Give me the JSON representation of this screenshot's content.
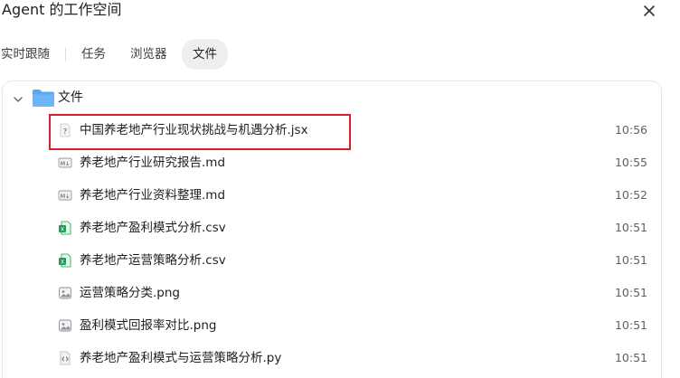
{
  "header": {
    "title": "Agent 的工作空间",
    "close_icon": "close-icon"
  },
  "tabs": [
    {
      "label": "实时跟随",
      "active": false
    },
    {
      "label": "任务",
      "active": false
    },
    {
      "label": "浏览器",
      "active": false
    },
    {
      "label": "文件",
      "active": true
    }
  ],
  "folder": {
    "label": "文件",
    "icon": "folder-icon",
    "expanded": true
  },
  "files": [
    {
      "name": "中国养老地产行业现状挑战与机遇分析.jsx",
      "time": "10:56",
      "icon": "unknown-file-icon"
    },
    {
      "name": "养老地产行业研究报告.md",
      "time": "10:55",
      "icon": "markdown-file-icon"
    },
    {
      "name": "养老地产行业资料整理.md",
      "time": "10:52",
      "icon": "markdown-file-icon"
    },
    {
      "name": "养老地产盈利模式分析.csv",
      "time": "10:51",
      "icon": "spreadsheet-file-icon"
    },
    {
      "name": "养老地产运营策略分析.csv",
      "time": "10:51",
      "icon": "spreadsheet-file-icon"
    },
    {
      "name": "运营策略分类.png",
      "time": "10:51",
      "icon": "image-file-icon"
    },
    {
      "name": "盈利模式回报率对比.png",
      "time": "10:51",
      "icon": "image-file-icon"
    },
    {
      "name": "养老地产盈利模式与运营策略分析.py",
      "time": "10:51",
      "icon": "code-file-icon"
    }
  ],
  "colors": {
    "folder": "#5aa9f2",
    "spreadsheet": "#1f9d55",
    "highlight": "#d7202a"
  }
}
